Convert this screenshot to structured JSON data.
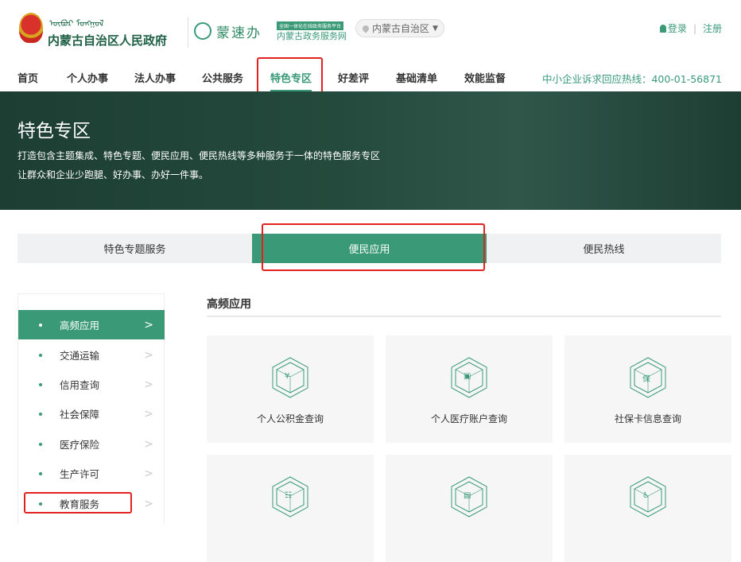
{
  "header": {
    "gov_mongolian": "ᠥᠪᠦᠷ ᠮᠣᠩᠭᠣᠯ",
    "gov_name": "内蒙古自治区人民政府",
    "service_name": "蒙速办",
    "service_badge": "全国一体化在线政务服务平台",
    "service_sub": "内蒙古政务服务网",
    "region": "内蒙古自治区",
    "login": "登录",
    "divider": "|",
    "register": "注册"
  },
  "nav": {
    "items": [
      "首页",
      "个人办事",
      "法人办事",
      "公共服务",
      "特色专区",
      "好差评",
      "基础清单",
      "效能监督"
    ],
    "active": 4,
    "hotline": "中小企业诉求回应热线：400-01-56871"
  },
  "banner": {
    "title": "特色专区",
    "desc1": "打造包含主题集成、特色专题、便民应用、便民热线等多种服务于一体的特色服务专区",
    "desc2": "让群众和企业少跑腿、好办事、办好一件事。"
  },
  "tabs": [
    "特色专题服务",
    "便民应用",
    "便民热线"
  ],
  "sidebar": {
    "items": [
      "高频应用",
      "交通运输",
      "信用查询",
      "社会保障",
      "医疗保险",
      "生产许可",
      "教育服务"
    ],
    "chevron": ">"
  },
  "main": {
    "section_title": "高频应用",
    "cards": [
      {
        "label": "个人公积金查询",
        "icon": "house-yuan-icon",
        "glyph": "¥"
      },
      {
        "label": "个人医疗账户查询",
        "icon": "wallet-icon",
        "glyph": "▣"
      },
      {
        "label": "社保卡信息查询",
        "icon": "shield-icon",
        "glyph": "保"
      },
      {
        "label": "",
        "icon": "id-card-user-icon",
        "glyph": "☷"
      },
      {
        "label": "",
        "icon": "card-shield-icon",
        "glyph": "▤"
      },
      {
        "label": "",
        "icon": "elderly-icon",
        "glyph": "♿"
      }
    ]
  },
  "colors": {
    "accent": "#3a9a78",
    "banner": "#1e3d33",
    "highlight": "#e0231f"
  }
}
